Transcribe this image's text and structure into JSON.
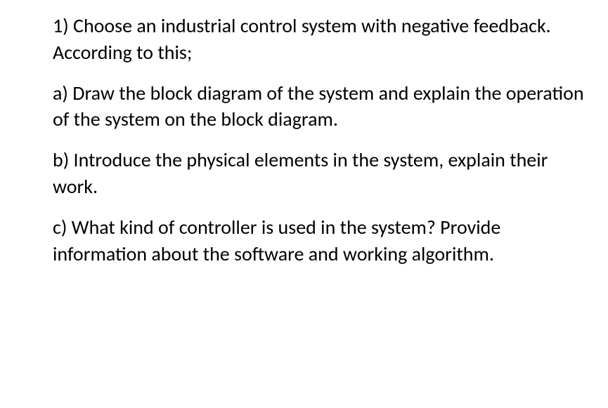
{
  "question": {
    "intro": "1) Choose an industrial control system with negative feedback. According to this;",
    "part_a": "a) Draw the block diagram of the system and explain the operation of the system on the block diagram.",
    "part_b": "b) Introduce the physical elements in the system, explain their work.",
    "part_c": "c) What kind of controller is used in the system?  Provide information about the software and working algorithm."
  }
}
